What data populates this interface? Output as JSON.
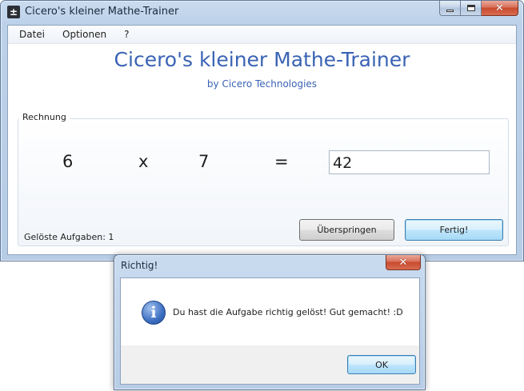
{
  "window": {
    "title": "Cicero's kleiner Mathe-Trainer",
    "icon": "plus-minus-icon",
    "icon_glyph": "±",
    "controls": {
      "minimize": "minimize-icon",
      "maximize": "maximize-icon",
      "close_glyph": "✕"
    }
  },
  "menu": {
    "items": [
      {
        "label": "Datei"
      },
      {
        "label": "Optionen"
      },
      {
        "label": "?"
      }
    ]
  },
  "header": {
    "title": "Cicero's kleiner Mathe-Trainer",
    "subtitle": "by Cicero Technologies"
  },
  "exercise": {
    "group_label": "Rechnung",
    "operand1": "6",
    "operator": "x",
    "operand2": "7",
    "equals": "=",
    "answer": "42"
  },
  "status": {
    "solved_label": "Gelöste Aufgaben: 1"
  },
  "buttons": {
    "skip": "Überspringen",
    "done": "Fertig!"
  },
  "dialog": {
    "title": "Richtig!",
    "close_glyph": "✕",
    "icon": "info-icon",
    "icon_glyph": "i",
    "message": "Du hast die Aufgabe richtig gelöst! Gut gemacht!  :D",
    "ok": "OK"
  },
  "colors": {
    "accent_text": "#3a63b4",
    "title_bar": "#bcd2ea",
    "close_button": "#c84a2f"
  }
}
